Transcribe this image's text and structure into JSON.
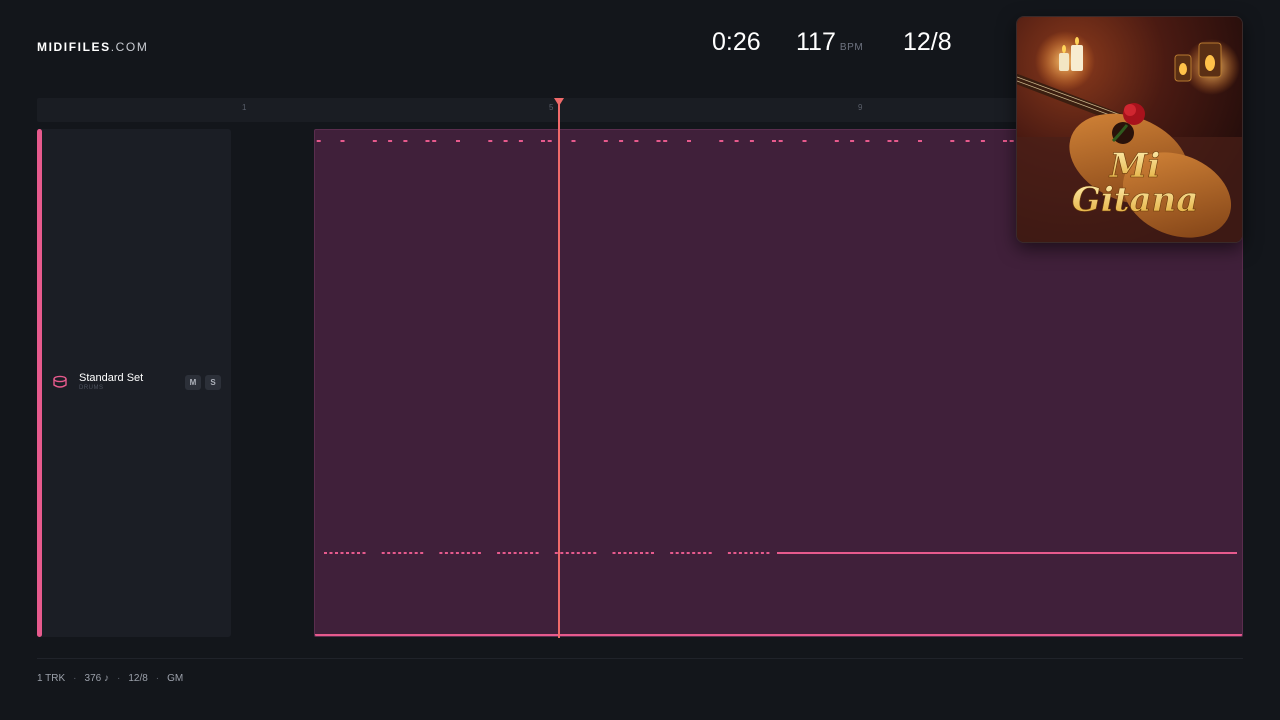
{
  "brand": {
    "name": "MIDIFILES",
    "tld": ".COM"
  },
  "stats": {
    "time": "0:26",
    "bpm": "117",
    "bpm_unit": "BPM",
    "time_signature": "12/8"
  },
  "ruler": {
    "markers": [
      "1",
      "5",
      "9"
    ]
  },
  "track": {
    "name": "Standard Set",
    "type": "DRUMS",
    "mute_label": "M",
    "solo_label": "S",
    "accent_color": "#e75a8d"
  },
  "cover": {
    "title_line1": "Mi",
    "title_line2": "Gitana"
  },
  "footer": {
    "tracks": "1 TRK",
    "notes": "376 ♪",
    "time_signature": "12/8",
    "standard": "GM"
  },
  "colors": {
    "background": "#13161b",
    "clip": "#40203a",
    "notes": "#e75a8d",
    "playhead": "#f06a6a"
  }
}
